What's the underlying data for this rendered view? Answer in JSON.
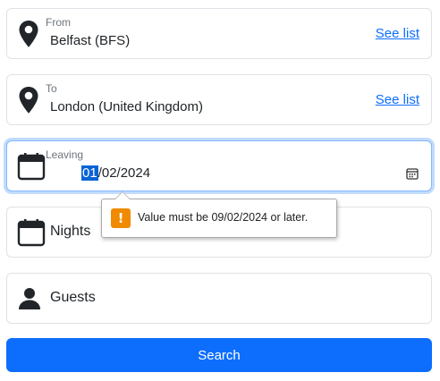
{
  "from": {
    "label": "From",
    "value": "Belfast (BFS)",
    "link": "See list",
    "icon": "map-pin-icon"
  },
  "to": {
    "label": "To",
    "value": "London (United Kingdom)",
    "link": "See list",
    "icon": "map-pin-icon"
  },
  "leaving": {
    "label": "Leaving",
    "day": "01",
    "rest": "/02/2024",
    "icon": "calendar-icon",
    "picker_icon": "calendar-picker-icon"
  },
  "validation": {
    "message": "Value must be 09/02/2024 or later.",
    "icon": "warning-icon"
  },
  "nights": {
    "placeholder": "Nights",
    "icon": "calendar-icon"
  },
  "guests": {
    "placeholder": "Guests",
    "icon": "person-icon"
  },
  "search": {
    "label": "Search"
  },
  "colors": {
    "primary": "#0d6efd",
    "warning": "#f08a00",
    "focus_border": "#86b7fe"
  }
}
